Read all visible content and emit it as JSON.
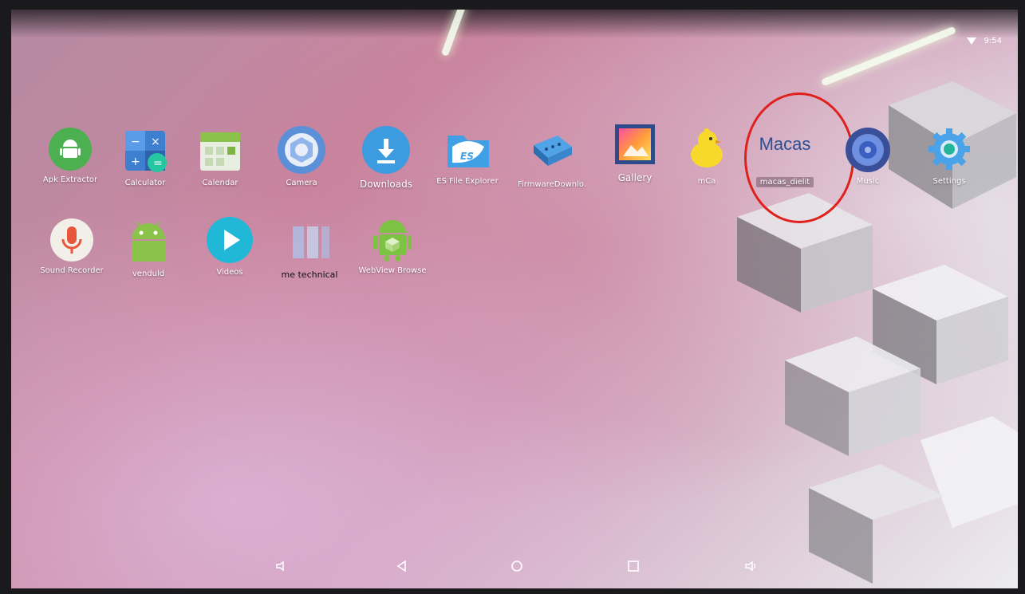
{
  "status": {
    "time": "9:54"
  },
  "apps_row1": [
    {
      "label": "Apk Extractor",
      "icon": "android-green-circle-icon"
    },
    {
      "label": "Calculator",
      "icon": "calculator-icon"
    },
    {
      "label": "Calendar",
      "icon": "calendar-icon"
    },
    {
      "label": "Camera",
      "icon": "camera-icon"
    },
    {
      "label": "Downloads",
      "icon": "download-icon"
    },
    {
      "label": "ES File Explorer",
      "icon": "es-folder-icon"
    },
    {
      "label": "FirmwareDownlo.",
      "icon": "serial-cable-icon"
    },
    {
      "label": "Gallery",
      "icon": "gallery-icon"
    },
    {
      "label": "mCa",
      "icon": "chick-icon"
    },
    {
      "label": "macas_dielit",
      "icon": "macas-text-icon",
      "icon_text": "Macas"
    },
    {
      "label": "Music",
      "icon": "music-speaker-icon"
    },
    {
      "label": "Settings",
      "icon": "gear-icon"
    }
  ],
  "apps_row2": [
    {
      "label": "Sound Recorder",
      "icon": "microphone-icon"
    },
    {
      "label": "venduld",
      "icon": "android-icon"
    },
    {
      "label": "Videos",
      "icon": "play-icon"
    },
    {
      "label": "me technical",
      "icon": "blank-app-icon"
    },
    {
      "label": "WebView Browse",
      "icon": "android-cube-icon"
    }
  ],
  "nav": [
    "volume-down-icon",
    "back-icon",
    "home-icon",
    "recents-icon",
    "volume-up-icon"
  ],
  "colors": {
    "highlight": "#e0201c"
  }
}
